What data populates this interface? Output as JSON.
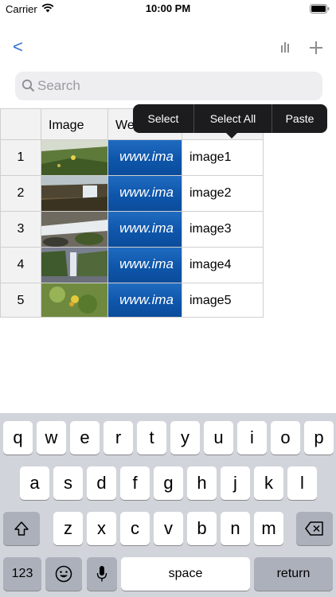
{
  "status_bar": {
    "carrier": "Carrier",
    "time": "10:00 PM"
  },
  "nav": {
    "back_label": "<"
  },
  "search": {
    "placeholder": "Search"
  },
  "sheet": {
    "headers": {
      "image": "Image",
      "web": "We"
    },
    "rows": [
      {
        "num": "1",
        "web": "www.ima",
        "name": "image1"
      },
      {
        "num": "2",
        "web": "www.ima",
        "name": "image2"
      },
      {
        "num": "3",
        "web": "www.ima",
        "name": "image3"
      },
      {
        "num": "4",
        "web": "www.ima",
        "name": "image4"
      },
      {
        "num": "5",
        "web": "www.ima",
        "name": "image5"
      }
    ]
  },
  "context_menu": {
    "items": [
      "Select",
      "Select All",
      "Paste"
    ]
  },
  "keyboard": {
    "row1": [
      "q",
      "w",
      "e",
      "r",
      "t",
      "y",
      "u",
      "i",
      "o",
      "p"
    ],
    "row2": [
      "a",
      "s",
      "d",
      "f",
      "g",
      "h",
      "j",
      "k",
      "l"
    ],
    "row3": [
      "z",
      "x",
      "c",
      "v",
      "b",
      "n",
      "m"
    ],
    "numbers_label": "123",
    "space_label": "space",
    "return_label": "return"
  },
  "colors": {
    "accent": "#2f6fd6",
    "menu_bg": "#1c1c1e",
    "keyboard_bg": "#d1d4da"
  }
}
